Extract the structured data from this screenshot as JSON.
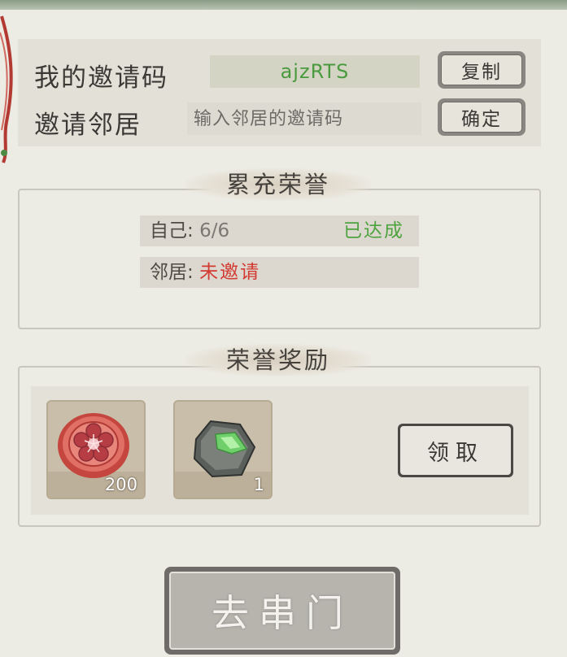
{
  "invite": {
    "my_code_label": "我的邀请码",
    "my_code_value": "ajzRTS",
    "copy_button": "复制",
    "neighbor_label": "邀请邻居",
    "neighbor_placeholder": "输入邻居的邀请码",
    "confirm_button": "确定"
  },
  "honor": {
    "title": "累充荣誉",
    "self_label": "自己:",
    "self_value": "6/6",
    "self_status": "已达成",
    "neighbor_label": "邻居:",
    "neighbor_status": "未邀请"
  },
  "rewards": {
    "title": "荣誉奖励",
    "items": [
      {
        "icon": "plum-blossom-token-icon",
        "count": "200"
      },
      {
        "icon": "jade-stone-icon",
        "count": "1"
      }
    ],
    "claim_button": "领取"
  },
  "footer": {
    "go_button": "去串门"
  },
  "colors": {
    "background": "#ecebe4",
    "achieved_green": "#4ea33f",
    "not_invited_red": "#d23a32",
    "code_green": "#4a9a3f"
  }
}
